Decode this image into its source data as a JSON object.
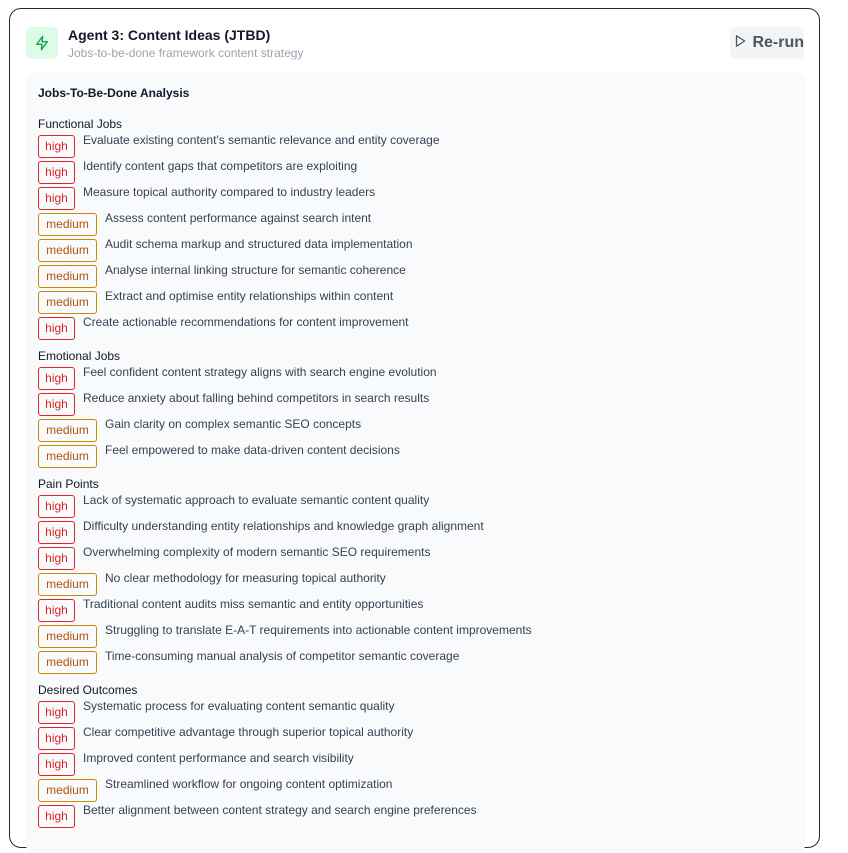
{
  "header": {
    "title": "Agent 3: Content Ideas (JTBD)",
    "subtitle": "Jobs-to-be-done framework content strategy",
    "rerun_label": "Re-run",
    "accent_color": "#16a34a"
  },
  "analysis": {
    "title": "Jobs-To-Be-Done Analysis",
    "sections": [
      {
        "title": "Functional Jobs",
        "items": [
          {
            "priority": "high",
            "text": "Evaluate existing content's semantic relevance and entity coverage"
          },
          {
            "priority": "high",
            "text": "Identify content gaps that competitors are exploiting"
          },
          {
            "priority": "high",
            "text": "Measure topical authority compared to industry leaders"
          },
          {
            "priority": "medium",
            "text": "Assess content performance against search intent"
          },
          {
            "priority": "medium",
            "text": "Audit schema markup and structured data implementation"
          },
          {
            "priority": "medium",
            "text": "Analyse internal linking structure for semantic coherence"
          },
          {
            "priority": "medium",
            "text": "Extract and optimise entity relationships within content"
          },
          {
            "priority": "high",
            "text": "Create actionable recommendations for content improvement"
          }
        ]
      },
      {
        "title": "Emotional Jobs",
        "items": [
          {
            "priority": "high",
            "text": "Feel confident content strategy aligns with search engine evolution"
          },
          {
            "priority": "high",
            "text": "Reduce anxiety about falling behind competitors in search results"
          },
          {
            "priority": "medium",
            "text": "Gain clarity on complex semantic SEO concepts"
          },
          {
            "priority": "medium",
            "text": "Feel empowered to make data-driven content decisions"
          }
        ]
      },
      {
        "title": "Pain Points",
        "items": [
          {
            "priority": "high",
            "text": "Lack of systematic approach to evaluate semantic content quality"
          },
          {
            "priority": "high",
            "text": "Difficulty understanding entity relationships and knowledge graph alignment"
          },
          {
            "priority": "high",
            "text": "Overwhelming complexity of modern semantic SEO requirements"
          },
          {
            "priority": "medium",
            "text": "No clear methodology for measuring topical authority"
          },
          {
            "priority": "high",
            "text": "Traditional content audits miss semantic and entity opportunities"
          },
          {
            "priority": "medium",
            "text": "Struggling to translate E-A-T requirements into actionable content improvements"
          },
          {
            "priority": "medium",
            "text": "Time-consuming manual analysis of competitor semantic coverage"
          }
        ]
      },
      {
        "title": "Desired Outcomes",
        "items": [
          {
            "priority": "high",
            "text": "Systematic process for evaluating content semantic quality"
          },
          {
            "priority": "high",
            "text": "Clear competitive advantage through superior topical authority"
          },
          {
            "priority": "high",
            "text": "Improved content performance and search visibility"
          },
          {
            "priority": "medium",
            "text": "Streamlined workflow for ongoing content optimization"
          },
          {
            "priority": "high",
            "text": "Better alignment between content strategy and search engine preferences"
          }
        ]
      }
    ]
  }
}
